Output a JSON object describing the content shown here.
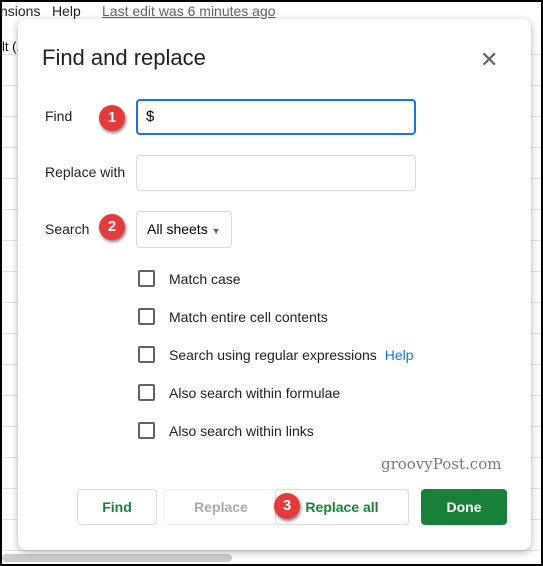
{
  "menubar": {
    "items": [
      "nsions",
      "Help"
    ],
    "last_edit": "Last edit was 6 minutes ago",
    "partial": "lt (."
  },
  "dialog": {
    "title": "Find and replace",
    "find_label": "Find",
    "find_value": "$",
    "replace_label": "Replace with",
    "replace_value": "",
    "search_label": "Search",
    "search_value": "All sheets",
    "options": [
      {
        "label": "Match case",
        "checked": false
      },
      {
        "label": "Match entire cell contents",
        "checked": false
      },
      {
        "label": "Search using regular expressions",
        "checked": false,
        "help": "Help"
      },
      {
        "label": "Also search within formulae",
        "checked": false
      },
      {
        "label": "Also search within links",
        "checked": false
      }
    ],
    "buttons": {
      "find": "Find",
      "replace": "Replace",
      "replace_all": "Replace all",
      "done": "Done"
    },
    "done_color": "#188038"
  },
  "badges": [
    "1",
    "2",
    "3"
  ],
  "watermark": "groovyPost.com"
}
